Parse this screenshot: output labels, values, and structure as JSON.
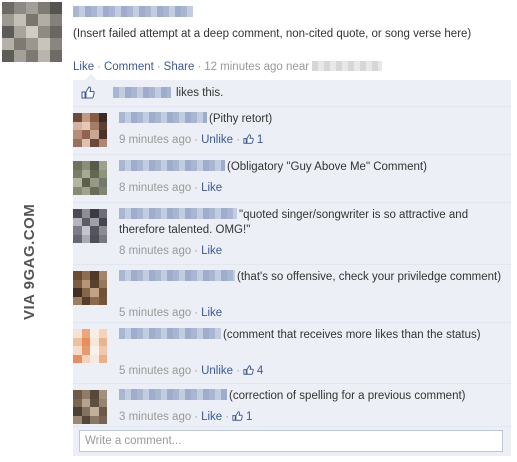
{
  "post": {
    "avatar_colors": [
      "#6c6a63",
      "#8d8a85",
      "#a29f98",
      "#7f7b74",
      "#55534f",
      "#9d9a93",
      "#c4c0b7",
      "#7a766f",
      "#b2aea5",
      "#85817a",
      "#5e5c58",
      "#a8a49c",
      "#d0ccc3",
      "#8f8b84",
      "#6a6762",
      "#b5b1a8",
      "#7e7a73",
      "#9b978f",
      "#c8c4bb",
      "#8a867f",
      "#5f5d58",
      "#a4a098",
      "#7d7972",
      "#b9b5ac",
      "#6e6b65"
    ],
    "text": "(Insert failed attempt at a deep comment, non-cited quote, or song verse here)",
    "actions": [
      "Like",
      "Comment",
      "Share"
    ],
    "time": "12 minutes ago",
    "near_label": "near"
  },
  "likes": {
    "text": "likes this."
  },
  "comments": [
    {
      "text": "(Pithy retort)",
      "time": "9 minutes ago",
      "action": "Unlike",
      "likes": "1",
      "avatar": [
        "#6d4a3c",
        "#c09a84",
        "#8a5b43",
        "#3b2a26",
        "#d3b4a1",
        "#e6c9b5",
        "#a47d68",
        "#5c3f35",
        "#b78d77",
        "#8e6552",
        "#c9a690",
        "#4a332b",
        "#9a715c",
        "#dfc2ae",
        "#6b4a3d",
        "#b08670"
      ]
    },
    {
      "text": "(Obligatory \"Guy Above Me\" Comment)",
      "time": "8 minutes ago",
      "action": "Like",
      "likes": "",
      "avatar": [
        "#6f735e",
        "#8b8f79",
        "#565a48",
        "#9da18b",
        "#7a7e68",
        "#a6aa94",
        "#636752",
        "#8f937d",
        "#b3b7a1",
        "#5b5f4b",
        "#969a84",
        "#74786a",
        "#878b75",
        "#a0a48e",
        "#696d58",
        "#818570"
      ]
    },
    {
      "text": "\"quoted singer/songwriter is so attractive and therefore talented. OMG!\"",
      "time": "8 minutes ago",
      "action": "Like",
      "likes": "",
      "avatar": [
        "#4a4b55",
        "#8c8d95",
        "#3a3b44",
        "#6d6e78",
        "#b4b5bd",
        "#5c5d66",
        "#9fa0a8",
        "#44454e",
        "#7b7c86",
        "#c4c5cc",
        "#53545d",
        "#8a8b93",
        "#666770",
        "#a9aab2",
        "#4e4f58",
        "#777882"
      ]
    },
    {
      "text": "(that's so offensive, check your priviledge comment)",
      "time": "5 minutes ago",
      "action": "Like",
      "likes": "",
      "avatar": [
        "#6a4c33",
        "#8e6d52",
        "#4e3826",
        "#a3836a",
        "#7c5c42",
        "#b49579",
        "#5a412d",
        "#977659",
        "#3f2e21",
        "#866548",
        "#c0a285",
        "#6f5039",
        "#9e7d60",
        "#553d2a",
        "#8a6a4e",
        "#74553c"
      ]
    },
    {
      "text": "(comment that receives more likes than the status)",
      "time": "5 minutes ago",
      "action": "Unlike",
      "likes": "4",
      "avatar": [
        "#f4e2d4",
        "#e9a77b",
        "#f7eee6",
        "#f3d3bb",
        "#eec0a0",
        "#e48f5c",
        "#f6e7db",
        "#ebb38e",
        "#f2dccb",
        "#e79a6b",
        "#f8f1ea",
        "#efc7a9",
        "#e58f60",
        "#f1d2ba",
        "#f7ebe0",
        "#eab08a"
      ]
    },
    {
      "text": "(correction of spelling for a previous comment)",
      "time": "3 minutes ago",
      "action": "Like",
      "likes": "1",
      "avatar": [
        "#6e5a48",
        "#8f7b67",
        "#57483a",
        "#a2907c",
        "#7a6654",
        "#b5a38f",
        "#5f4f40",
        "#978470",
        "#4c3f33",
        "#85725e",
        "#c1af9b",
        "#6a5848",
        "#9c8975",
        "#54463a",
        "#8b7864",
        "#776452"
      ]
    }
  ],
  "write_placeholder": "Write a comment...",
  "watermark": "VIA 9GAG.COM",
  "colors": {
    "link": "#3b5998",
    "meta": "#999999",
    "feed_bg": "#eceff5"
  }
}
